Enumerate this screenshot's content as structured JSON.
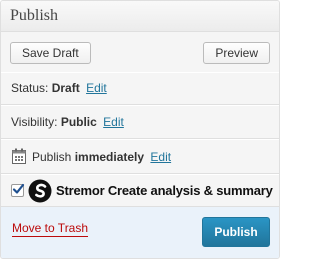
{
  "box": {
    "title": "Publish"
  },
  "actions": {
    "save_draft_label": "Save Draft",
    "preview_label": "Preview"
  },
  "status": {
    "label": "Status:",
    "value": "Draft",
    "edit_label": "Edit"
  },
  "visibility": {
    "label": "Visibility:",
    "value": "Public",
    "edit_label": "Edit"
  },
  "schedule": {
    "label": "Publish",
    "value": "immediately",
    "edit_label": "Edit",
    "icon": "calendar-icon"
  },
  "stremor": {
    "checked": true,
    "label": "Stremor Create analysis & summary",
    "icon": "stremor-logo-icon"
  },
  "major_actions": {
    "trash_label": "Move to Trash",
    "publish_label": "Publish"
  },
  "colors": {
    "link": "#21759b",
    "trash": "#bc0b0b",
    "publish_button": "#21759b",
    "major_bg": "#eaf2fa"
  }
}
